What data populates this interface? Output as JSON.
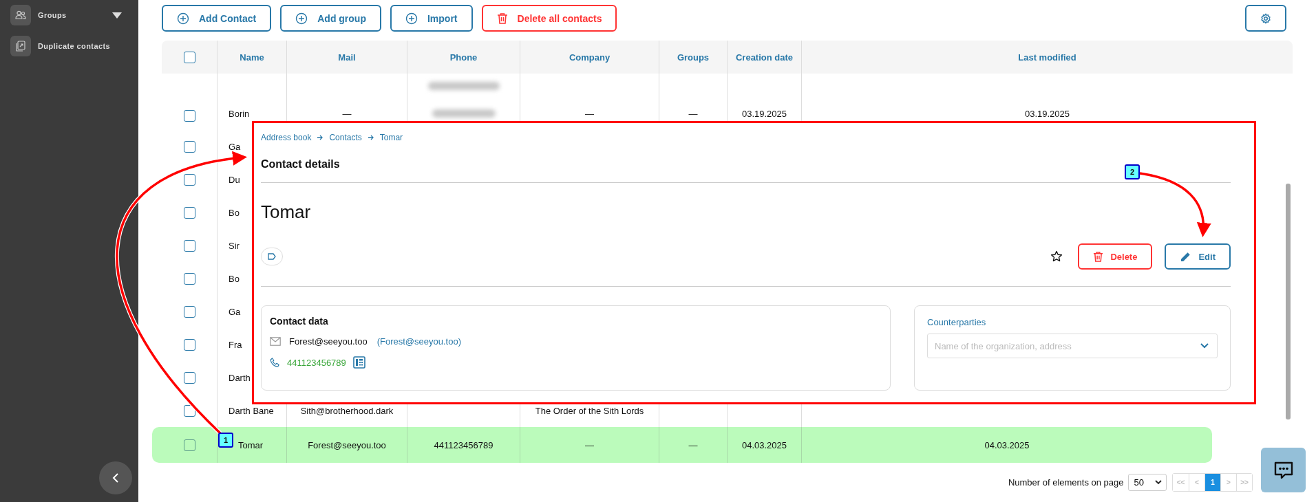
{
  "sidebar": {
    "items": [
      {
        "label": "Groups",
        "kind": "groups"
      },
      {
        "label": "Duplicate contacts",
        "kind": "duplicates"
      }
    ]
  },
  "toolbar": {
    "buttons": [
      {
        "label": "Add Contact",
        "kind": "add"
      },
      {
        "label": "Add group",
        "kind": "add"
      },
      {
        "label": "Import",
        "kind": "add"
      },
      {
        "label": "Delete all contacts",
        "kind": "danger"
      }
    ]
  },
  "table": {
    "all_checked": false,
    "columns": [
      "Name",
      "Mail",
      "Phone",
      "Company",
      "Groups",
      "Creation date",
      "Last modified"
    ],
    "rows": [
      {
        "name": "Borin",
        "mail": "—",
        "phone_blurred": true,
        "company": "—",
        "groups": "—",
        "created": "03.19.2025",
        "modified": "03.19.2025",
        "checked": false,
        "selected": false
      },
      {
        "name": "Ga",
        "phone_blurred": false,
        "checked": false,
        "selected": false
      },
      {
        "name": "Du",
        "phone_blurred": false,
        "checked": false,
        "selected": false
      },
      {
        "name": "Bo",
        "phone_blurred": false,
        "checked": false,
        "selected": false
      },
      {
        "name": "Sir",
        "phone_blurred": false,
        "checked": false,
        "selected": false
      },
      {
        "name": "Bo",
        "phone_blurred": false,
        "checked": false,
        "selected": false
      },
      {
        "name": "Ga",
        "phone_blurred": false,
        "checked": false,
        "selected": false
      },
      {
        "name": "Fra",
        "phone_blurred": false,
        "checked": false,
        "selected": false
      },
      {
        "name": "Darth",
        "phone_blurred": false,
        "checked": false,
        "selected": false
      },
      {
        "name": "Darth Bane",
        "mail": "Sith@brotherhood.dark",
        "phone_blurred": false,
        "company": "The Order of the Sith Lords",
        "checked": false,
        "selected": false
      },
      {
        "name": "Tomar",
        "mail": "Forest@seeyou.too",
        "phone": "441123456789",
        "phone_blurred": false,
        "company": "—",
        "groups": "—",
        "created": "04.03.2025",
        "modified": "04.03.2025",
        "checked": false,
        "selected": true
      }
    ]
  },
  "pagination": {
    "label": "Number of elements on page",
    "page_size": "50",
    "pages": [
      {
        "label": "<<",
        "disabled": true,
        "selected": false
      },
      {
        "label": "<",
        "disabled": true,
        "selected": false
      },
      {
        "label": "1",
        "disabled": false,
        "selected": true
      },
      {
        "label": ">",
        "disabled": true,
        "selected": false
      },
      {
        "label": ">>",
        "disabled": true,
        "selected": false
      }
    ]
  },
  "contact_panel": {
    "breadcrumb": [
      "Address book",
      "Contacts",
      "Tomar"
    ],
    "title": "Contact details",
    "name": "Tomar",
    "favorite": false,
    "actions": [
      {
        "label": "Delete",
        "kind": "danger"
      },
      {
        "label": "Edit",
        "kind": "edit"
      }
    ],
    "contact_data": {
      "title": "Contact data",
      "email": "Forest@seeyou.too",
      "email_link": "(Forest@seeyou.too)",
      "phone": "441123456789"
    },
    "counterparties": {
      "label": "Counterparties",
      "placeholder": "Name of the organization, address"
    }
  },
  "annotations": [
    {
      "label": "1"
    },
    {
      "label": "2"
    }
  ]
}
